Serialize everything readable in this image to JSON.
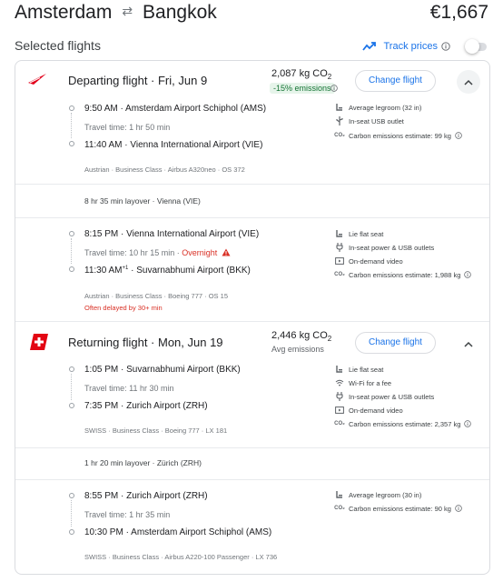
{
  "header": {
    "origin": "Amsterdam",
    "destination": "Bangkok",
    "price": "€1,667"
  },
  "selected_flights_title": "Selected flights",
  "track_prices_label": "Track prices",
  "change_flight_label": "Change flight",
  "departing": {
    "title": "Departing flight · Fri, Jun 9",
    "co2": "2,087 kg CO",
    "co2_sub": "2",
    "emissions_badge": "-15% emissions",
    "seg1": {
      "depart_time": "9:50 AM",
      "depart_airport": "Amsterdam Airport Schiphol (AMS)",
      "travel_time": "Travel time: 1 hr 50 min",
      "arrive_time": "11:40 AM",
      "arrive_airport": "Vienna International Airport (VIE)",
      "meta": "Austrian · Business Class · Airbus A320neo · OS 372",
      "amenities": [
        "Average legroom (32 in)",
        "In-seat USB outlet",
        "Carbon emissions estimate: 99 kg"
      ]
    },
    "layover": "8 hr 35 min layover · Vienna (VIE)",
    "seg2": {
      "depart_time": "8:15 PM",
      "depart_airport": "Vienna International Airport (VIE)",
      "travel_time": "Travel time: 10 hr 15 min",
      "overnight": "Overnight",
      "arrive_time": "11:30 AM",
      "arrive_sup": "+1",
      "arrive_airport": "Suvarnabhumi Airport (BKK)",
      "meta": "Austrian · Business Class · Boeing 777 · OS 15",
      "delay": "Often delayed by 30+ min",
      "amenities": [
        "Lie flat seat",
        "In-seat power & USB outlets",
        "On-demand video",
        "Carbon emissions estimate: 1,988 kg"
      ]
    }
  },
  "returning": {
    "title": "Returning flight · Mon, Jun 19",
    "co2": "2,446 kg CO",
    "co2_sub": "2",
    "avg_label": "Avg emissions",
    "seg1": {
      "depart_time": "1:05 PM",
      "depart_airport": "Suvarnabhumi Airport (BKK)",
      "travel_time": "Travel time: 11 hr 30 min",
      "arrive_time": "7:35 PM",
      "arrive_airport": "Zurich Airport (ZRH)",
      "meta": "SWISS · Business Class · Boeing 777 · LX 181",
      "amenities": [
        "Lie flat seat",
        "Wi-Fi for a fee",
        "In-seat power & USB outlets",
        "On-demand video",
        "Carbon emissions estimate: 2,357 kg"
      ]
    },
    "layover": "1 hr 20 min layover · Zürich (ZRH)",
    "seg2": {
      "depart_time": "8:55 PM",
      "depart_airport": "Zurich Airport (ZRH)",
      "travel_time": "Travel time: 1 hr 35 min",
      "arrive_time": "10:30 PM",
      "arrive_airport": "Amsterdam Airport Schiphol (AMS)",
      "meta": "SWISS · Business Class · Airbus A220-100 Passenger · LX 736",
      "amenities": [
        "Average legroom (30 in)",
        "Carbon emissions estimate: 90 kg"
      ]
    }
  },
  "colors": {
    "accent": "#1a73e8",
    "austrian_red": "#e2001a",
    "swiss_red": "#e30613",
    "warning": "#d93025",
    "good": "#137333"
  }
}
